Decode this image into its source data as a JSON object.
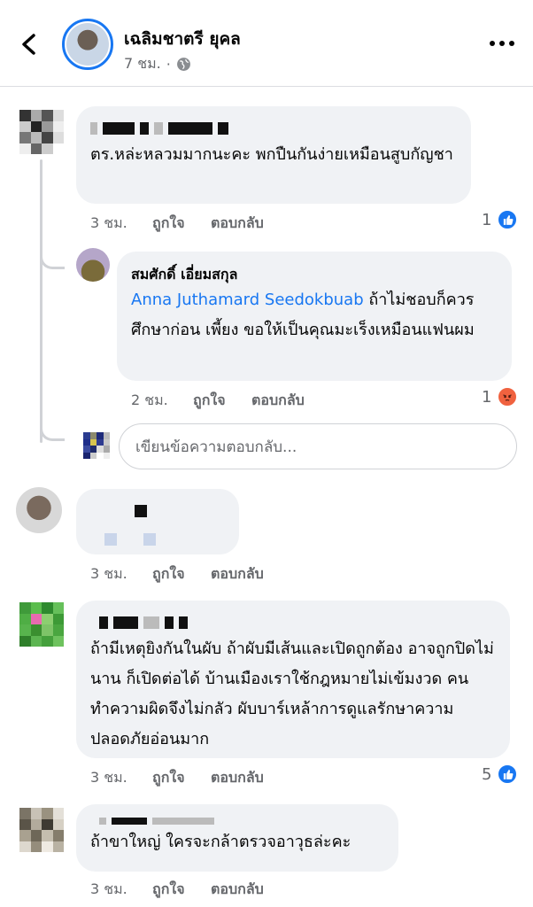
{
  "header": {
    "name": "เฉลิมชาตรี ยุคล",
    "time": "7 ชม.",
    "separator": "·"
  },
  "comments": [
    {
      "text": "ตร.หล่ะหลวมมากนะคะ พกปืนกันง่ายเหมือนสูบกัญชา",
      "time": "3 ชม.",
      "like_label": "ถูกใจ",
      "reply_label": "ตอบกลับ",
      "reaction_count": "1"
    },
    {
      "author": "สมศักดิ์ เอี่ยมสกุล",
      "mention": "Anna Juthamard Seedokbuab",
      "text": " ถ้าไม่ชอบก็ควรศึกษาก่อน เพี้ยง ขอให้เป็นคุณมะเร็งเหมือนแฟนผม",
      "time": "2 ชม.",
      "like_label": "ถูกใจ",
      "reply_label": "ตอบกลับ",
      "reaction_count": "1"
    },
    {
      "text": "",
      "time": "3 ชม.",
      "like_label": "ถูกใจ",
      "reply_label": "ตอบกลับ"
    },
    {
      "text": "ถ้ามีเหตุยิงกันในผับ ถ้าผับมีเส้นและเปิดถูกต้อง อาจถูกปิดไม่นาน ก็เปิดต่อได้ บ้านเมืองเราใช้กฎหมายไม่เข้มงวด คนทำความผิดจึงไม่กลัว ผับบาร์เหล้าการดูแลรักษาความปลอดภัยอ่อนมาก",
      "time": "3 ชม.",
      "like_label": "ถูกใจ",
      "reply_label": "ตอบกลับ",
      "reaction_count": "5"
    },
    {
      "text": "ถ้าขาใหญ่ ใครจะกล้าตรวจอาวุธล่ะคะ",
      "time": "3 ชม.",
      "like_label": "ถูกใจ",
      "reply_label": "ตอบกลับ"
    }
  ],
  "reply_input": {
    "placeholder": "เขียนข้อความตอบกลับ..."
  },
  "colors": {
    "accent": "#1877f2",
    "bubble": "#f0f2f5",
    "meta": "#65676b"
  }
}
